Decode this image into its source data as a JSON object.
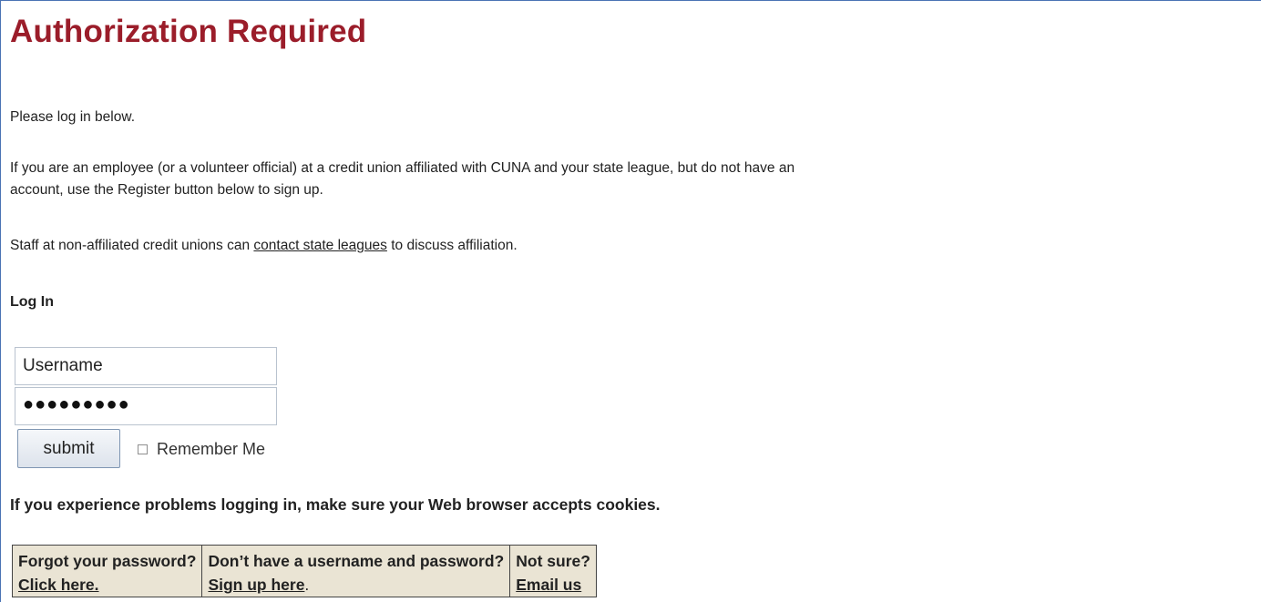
{
  "page": {
    "title": "Authorization Required"
  },
  "intro": {
    "line1": "Please log in below.",
    "line2": "If you are an employee (or a volunteer official) at a credit union affiliated with CUNA and your state league, but do not have an",
    "line2b": "account, use the Register button below to sign up.",
    "line3_prefix": "Staff at non-affiliated credit unions can ",
    "line3_link": "contact state leagues",
    "line3_suffix": " to discuss affiliation."
  },
  "login": {
    "heading": "Log In",
    "username_value": "Username",
    "password_value": "●●●●●●●●●",
    "submit_label": "submit",
    "remember_label": "Remember Me",
    "remember_checked": false
  },
  "notice": "If you experience problems logging in, make sure your Web browser accepts cookies.",
  "help_table": {
    "cells": [
      {
        "title": "Forgot your password?",
        "link": "Click here.",
        "suffix": ""
      },
      {
        "title": "Don’t have a username and password?",
        "link": "Sign up here",
        "suffix": "."
      },
      {
        "title": "Not sure?",
        "link": "Email us",
        "suffix": ""
      }
    ]
  },
  "colors": {
    "title": "#9b1d2a",
    "table_bg": "#eae4d4",
    "frame_border": "#4a73b4"
  }
}
